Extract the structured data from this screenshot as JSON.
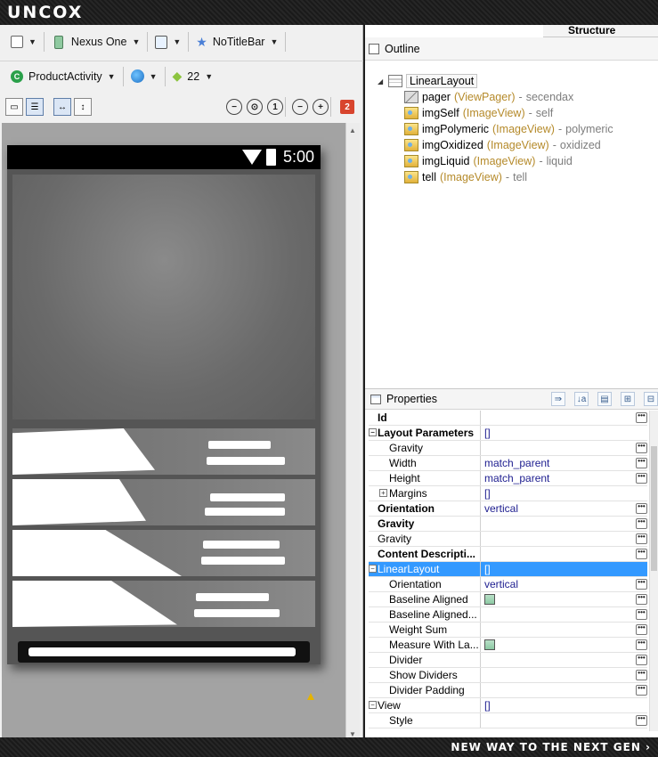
{
  "brand": "UNCOX",
  "tagline": "NEW WAY TO THE NEXT GEN ›",
  "toolbar": {
    "device": "Nexus One",
    "theme": "NoTitleBar",
    "activity": "ProductActivity",
    "api_level": "22",
    "error_count": "2"
  },
  "device_preview": {
    "clock": "5:00"
  },
  "structure_tab": "Structure",
  "outline": {
    "title": "Outline",
    "root": "LinearLayout",
    "children": [
      {
        "id": "pager",
        "type": "(ViewPager)",
        "sep": " - ",
        "text": "secendax",
        "icon": "viewpager-icon"
      },
      {
        "id": "imgSelf",
        "type": "(ImageView)",
        "sep": " - ",
        "text": "self",
        "icon": "imageview-icon"
      },
      {
        "id": "imgPolymeric",
        "type": "(ImageView)",
        "sep": " - ",
        "text": "polymeric",
        "icon": "imageview-icon"
      },
      {
        "id": "imgOxidized",
        "type": "(ImageView)",
        "sep": " - ",
        "text": "oxidized",
        "icon": "imageview-icon"
      },
      {
        "id": "imgLiquid",
        "type": "(ImageView)",
        "sep": " - ",
        "text": "liquid",
        "icon": "imageview-icon"
      },
      {
        "id": "tell",
        "type": "(ImageView)",
        "sep": " - ",
        "text": "tell",
        "icon": "imageview-icon"
      }
    ]
  },
  "properties": {
    "title": "Properties",
    "rows": [
      {
        "name": "Id",
        "value": "",
        "bold": true,
        "indent": 1,
        "toggle": "",
        "ellipsis": true,
        "checkbox": false
      },
      {
        "name": "Layout Parameters",
        "value": "[]",
        "bold": true,
        "indent": 1,
        "toggle": "−",
        "ellipsis": false,
        "checkbox": false
      },
      {
        "name": "Gravity",
        "value": "",
        "bold": false,
        "indent": 2,
        "toggle": "",
        "ellipsis": true,
        "checkbox": false
      },
      {
        "name": "Width",
        "value": "match_parent",
        "bold": false,
        "indent": 2,
        "toggle": "",
        "ellipsis": true,
        "checkbox": false
      },
      {
        "name": "Height",
        "value": "match_parent",
        "bold": false,
        "indent": 2,
        "toggle": "",
        "ellipsis": true,
        "checkbox": false
      },
      {
        "name": "Margins",
        "value": "[]",
        "bold": false,
        "indent": 2,
        "toggle": "+",
        "ellipsis": false,
        "checkbox": false
      },
      {
        "name": "Orientation",
        "value": "vertical",
        "bold": true,
        "indent": 1,
        "toggle": "",
        "ellipsis": true,
        "checkbox": false
      },
      {
        "name": "Gravity",
        "value": "",
        "bold": true,
        "indent": 1,
        "toggle": "",
        "ellipsis": true,
        "checkbox": false
      },
      {
        "name": "Gravity",
        "value": "",
        "bold": false,
        "indent": 1,
        "toggle": "",
        "ellipsis": true,
        "checkbox": false
      },
      {
        "name": "Content Descripti...",
        "value": "",
        "bold": true,
        "indent": 1,
        "toggle": "",
        "ellipsis": true,
        "checkbox": false
      },
      {
        "name": "LinearLayout",
        "value": "[]",
        "bold": false,
        "indent": 1,
        "toggle": "−",
        "ellipsis": false,
        "checkbox": false,
        "selected": true
      },
      {
        "name": "Orientation",
        "value": "vertical",
        "bold": false,
        "indent": 2,
        "toggle": "",
        "ellipsis": true,
        "checkbox": false
      },
      {
        "name": "Baseline Aligned",
        "value": "",
        "bold": false,
        "indent": 2,
        "toggle": "",
        "ellipsis": true,
        "checkbox": true
      },
      {
        "name": "Baseline Aligned...",
        "value": "",
        "bold": false,
        "indent": 2,
        "toggle": "",
        "ellipsis": true,
        "checkbox": false
      },
      {
        "name": "Weight Sum",
        "value": "",
        "bold": false,
        "indent": 2,
        "toggle": "",
        "ellipsis": true,
        "checkbox": false
      },
      {
        "name": "Measure With La...",
        "value": "",
        "bold": false,
        "indent": 2,
        "toggle": "",
        "ellipsis": true,
        "checkbox": true
      },
      {
        "name": "Divider",
        "value": "",
        "bold": false,
        "indent": 2,
        "toggle": "",
        "ellipsis": true,
        "checkbox": false
      },
      {
        "name": "Show Dividers",
        "value": "",
        "bold": false,
        "indent": 2,
        "toggle": "",
        "ellipsis": true,
        "checkbox": false
      },
      {
        "name": "Divider Padding",
        "value": "",
        "bold": false,
        "indent": 2,
        "toggle": "",
        "ellipsis": true,
        "checkbox": false
      },
      {
        "name": "View",
        "value": "[]",
        "bold": false,
        "indent": 1,
        "toggle": "−",
        "ellipsis": false,
        "checkbox": false
      },
      {
        "name": "Style",
        "value": "",
        "bold": false,
        "indent": 2,
        "toggle": "",
        "ellipsis": true,
        "checkbox": false
      }
    ]
  }
}
